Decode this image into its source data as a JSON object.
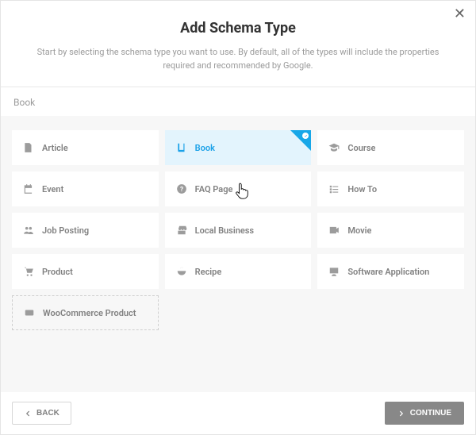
{
  "header": {
    "title": "Add Schema Type",
    "subtitle": "Start by selecting the schema type you want to use. By default, all of the types will include the properties required and recommended by Google."
  },
  "filter_value": "Book",
  "types": [
    {
      "id": "article",
      "label": "Article",
      "icon": "file-text"
    },
    {
      "id": "book",
      "label": "Book",
      "icon": "book",
      "selected": true
    },
    {
      "id": "course",
      "label": "Course",
      "icon": "grad-cap"
    },
    {
      "id": "event",
      "label": "Event",
      "icon": "calendar"
    },
    {
      "id": "faq",
      "label": "FAQ Page",
      "icon": "question"
    },
    {
      "id": "howto",
      "label": "How To",
      "icon": "list"
    },
    {
      "id": "jobposting",
      "label": "Job Posting",
      "icon": "users"
    },
    {
      "id": "localbusiness",
      "label": "Local Business",
      "icon": "store"
    },
    {
      "id": "movie",
      "label": "Movie",
      "icon": "video"
    },
    {
      "id": "product",
      "label": "Product",
      "icon": "cart"
    },
    {
      "id": "recipe",
      "label": "Recipe",
      "icon": "bowl"
    },
    {
      "id": "software",
      "label": "Software Application",
      "icon": "monitor"
    },
    {
      "id": "woocommerce",
      "label": "WooCommerce Product",
      "icon": "woo",
      "dashed": true
    }
  ],
  "buttons": {
    "back": "BACK",
    "continue": "CONTINUE"
  },
  "colors": {
    "accent": "#18a7e8",
    "selected_bg": "#e3f4fd",
    "muted": "#888888"
  }
}
